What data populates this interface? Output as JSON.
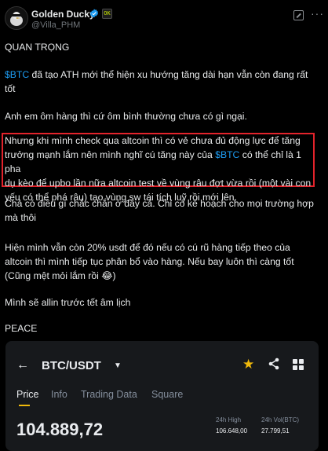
{
  "header": {
    "name": "Golden Ducky",
    "handle": "@Villa_PHM",
    "affiliate_badge_text": "OK"
  },
  "tweet": {
    "p1": "QUAN TRỌNG",
    "p2_ticker": "$BTC",
    "p2_line1": " đã tạo ATH mới thể hiện xu hướng tăng dài hạn vẫn còn đang rất",
    "p2_line2": "tốt",
    "p3": "Anh em ôm hàng thì cứ ôm bình thường chưa có gì ngại.",
    "p4_line1": "Nhưng khi mình check qua altcoin thì có vẻ chưa đủ động lực để tăng",
    "p4_line2_a": "trưởng mạnh lắm nên mình nghĩ cú tăng này của ",
    "p4_ticker": "$BTC",
    "p4_line2_b": " có thể chỉ là 1 pha",
    "p4_line3": "dụ kèo để upbo lần nữa altcoin test về vùng râu đợt vừa rồi (một vài con",
    "p4_line4": "yếu có thể phá râu) tạo vùng sw tái tích luỹ rồi mới lên.",
    "p5_line1": "Chả có điều gì chắc chắn ở đây cả. Chỉ có kế hoạch cho mọi trường hợp",
    "p5_line2": "mà thôi",
    "p6_line1": "Hiện mình vẫn còn 20% usdt để đó nếu có cú rũ hàng tiếp theo của",
    "p6_line2": "altcoin thì mình tiếp tục phân bổ vào hàng. Nếu bay luôn thì càng tốt",
    "p6_line3": "(Cũng mệt mỏi lắm rồi 😂)",
    "p7": "Mình sẽ allin trước tết âm lịch",
    "p8": "PEACE"
  },
  "card": {
    "pair": "BTC/USDT",
    "tabs": [
      "Price",
      "Info",
      "Trading Data",
      "Square"
    ],
    "active_tab": "Price",
    "price": "104.889,72",
    "high_label": "24h High",
    "high_value": "106.648,00",
    "vol_label": "24h Vol(BTC)",
    "vol_value": "27.799,51",
    "accent_color": "#f0b90b"
  }
}
